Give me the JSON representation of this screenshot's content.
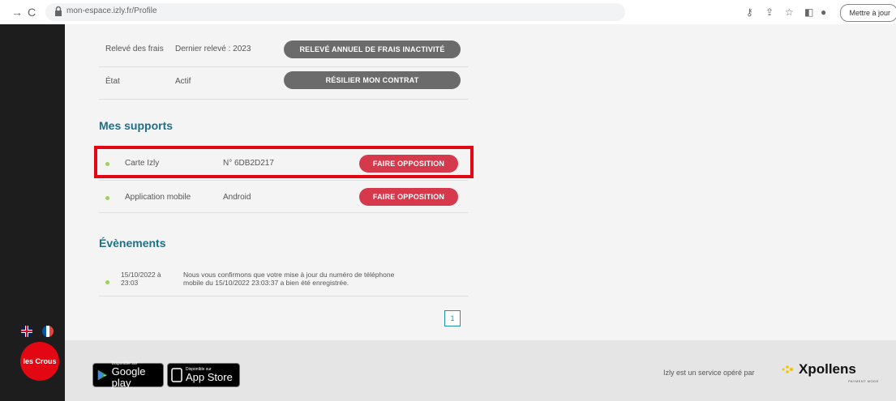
{
  "browser": {
    "url": "mon-espace.izly.fr/Profile",
    "update_label": "Mettre à jour"
  },
  "account": {
    "rows": [
      {
        "label": "Relevé des frais",
        "value": "Dernier relevé : 2023",
        "button": "RELEVÉ ANNUEL DE FRAIS INACTIVITÉ"
      },
      {
        "label": "État",
        "value": "Actif",
        "button": "RÉSILIER MON CONTRAT"
      }
    ]
  },
  "supports": {
    "title": "Mes supports",
    "items": [
      {
        "name": "Carte Izly",
        "detail": "N° 6DB2D217",
        "button": "FAIRE OPPOSITION"
      },
      {
        "name": "Application mobile",
        "detail": "Android",
        "button": "FAIRE OPPOSITION"
      }
    ]
  },
  "events": {
    "title": "Évènements",
    "items": [
      {
        "date_line1": "15/10/2022 à",
        "date_line2": "23:03",
        "message_line1": "Nous vous confirmons que votre mise à jour du numéro de téléphone",
        "message_line2": "mobile du 15/10/2022 23:03:37 a bien été enregistrée."
      }
    ]
  },
  "pagination": {
    "current": "1"
  },
  "sidebar": {
    "crous_label": "les Crous"
  },
  "footer": {
    "google_small": "Disponible sur",
    "google_big": "Google play",
    "apple_small": "Disponible sur",
    "apple_big": "App Store",
    "service_text": "Izly est un service opéré par",
    "brand": "Xpollens",
    "brand_sub": "PAYMENT MODE"
  },
  "colors": {
    "accent_red": "#d6394b",
    "title_blue": "#1f6f87",
    "status_green": "#9bd15d"
  }
}
